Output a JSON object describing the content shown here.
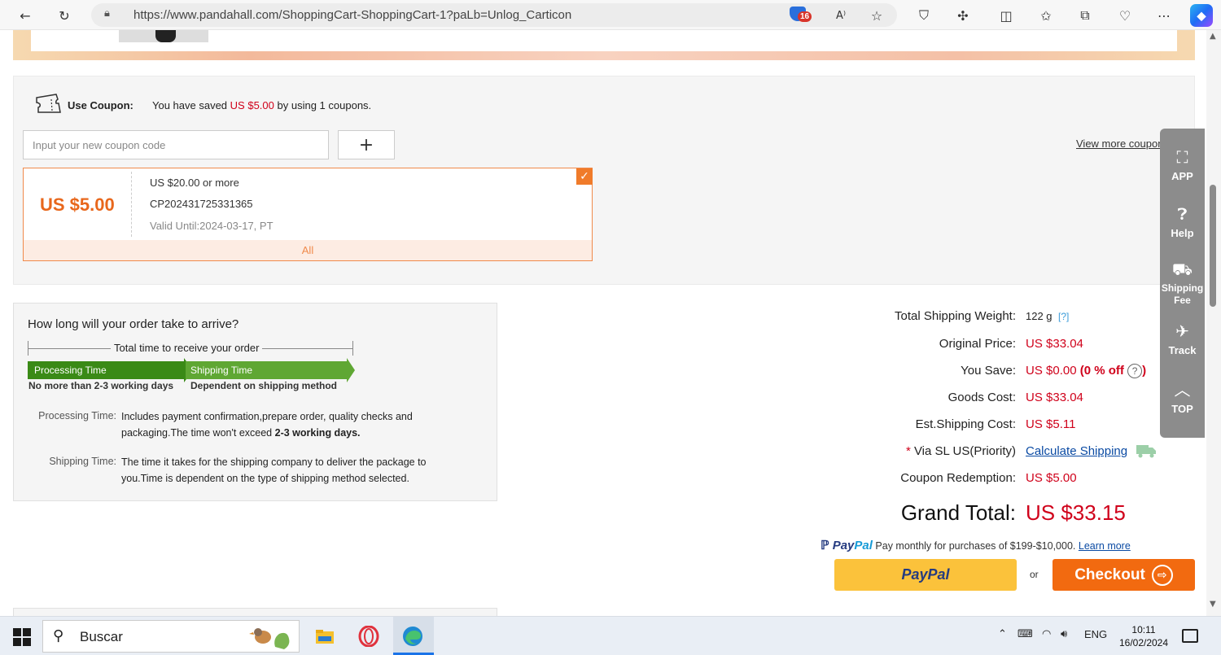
{
  "browser": {
    "url": "https://www.pandahall.com/ShoppingCart-ShoppingCart-1?paLb=Unlog_Carticon",
    "extension_badge": "16"
  },
  "coupon": {
    "label": "Use Coupon:",
    "saved_prefix": "You have saved",
    "saved_amount": "US $5.00",
    "saved_middle": "by using",
    "saved_count": "1",
    "saved_suffix": "coupons.",
    "input_placeholder": "Input your new coupon code",
    "add_label": "+",
    "view_more": "View more coupons",
    "card": {
      "amount": "US $5.00",
      "condition": "US $20.00 or more",
      "code": "CP202431725331365",
      "valid_until": "Valid Until:2024-03-17, PT",
      "scope": "All",
      "checked": true
    }
  },
  "delivery": {
    "title": "How long will your order take to arrive?",
    "total_label": "Total time to receive your order",
    "processing_label": "Processing Time",
    "processing_sub": "No more than 2-3 working days",
    "shipping_label": "Shipping Time",
    "shipping_sub": "Dependent on shipping method",
    "processing_desc_label": "Processing Time:",
    "processing_desc": "Includes payment confirmation,prepare order, quality checks and packaging.The time won't exceed",
    "processing_desc_bold": "2-3 working days.",
    "shipping_desc_label": "Shipping Time:",
    "shipping_desc": "The time it takes for the shipping company to deliver the package to you.Time is dependent on the type of shipping method selected."
  },
  "summary": {
    "weight_label": "Total Shipping Weight:",
    "weight_value": "122 g",
    "weight_help": "[?]",
    "original_label": "Original Price:",
    "original_value": "US $33.04",
    "save_label": "You Save:",
    "save_value": "US $0.00",
    "save_pct": "(0 % off",
    "save_close": ")",
    "goods_label": "Goods Cost:",
    "goods_value": "US $33.04",
    "ship_label": "Est.Shipping Cost:",
    "ship_value": "US $5.11",
    "via_star": "*",
    "via_label": "Via SL US(Priority)",
    "calc_link": "Calculate Shipping",
    "coupon_label": "Coupon Redemption:",
    "coupon_value": "US $5.00",
    "grand_label": "Grand Total:",
    "grand_value": "US $33.15",
    "paypal_brand_1": "Pay",
    "paypal_brand_2": "Pal",
    "paypal_text": "Pay monthly for purchases of $199-$10,000.",
    "learn_more": "Learn more",
    "paypal_button": "PayPal",
    "or": "or",
    "checkout": "Checkout"
  },
  "side_panel": {
    "items": [
      "APP",
      "Help",
      "Shipping Fee",
      "Track",
      "TOP"
    ]
  },
  "taskbar": {
    "search_text": "Buscar",
    "language": "ENG",
    "time": "10:11",
    "date": "16/02/2024"
  }
}
